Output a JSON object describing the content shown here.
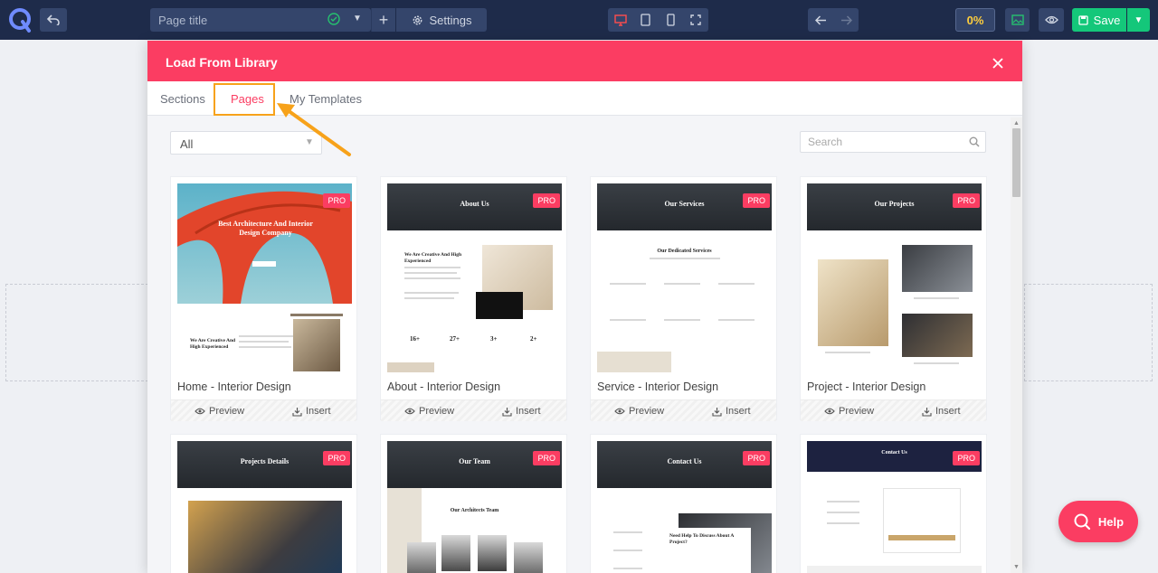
{
  "toolbar": {
    "title_placeholder": "Page title",
    "settings_label": "Settings",
    "progress": "0%",
    "save_label": "Save"
  },
  "modal": {
    "title": "Load From Library",
    "tabs": [
      {
        "label": "Sections"
      },
      {
        "label": "Pages"
      },
      {
        "label": "My Templates"
      }
    ],
    "filter_value": "All",
    "search_placeholder": "Search",
    "cards": [
      {
        "name": "Home - Interior Design",
        "badge": "PRO",
        "preview": "Preview",
        "insert": "Insert",
        "thumb_heading": "Best Architecture And Interior Design Company",
        "thumb_sub": "We Are Creative And High Experienced"
      },
      {
        "name": "About - Interior Design",
        "badge": "PRO",
        "preview": "Preview",
        "insert": "Insert",
        "thumb_heading": "About Us",
        "thumb_sub": "We Are Creative And High Experienced",
        "stats": [
          "16+",
          "27+",
          "3+",
          "2+"
        ]
      },
      {
        "name": "Service - Interior Design",
        "badge": "PRO",
        "preview": "Preview",
        "insert": "Insert",
        "thumb_heading": "Our Services",
        "thumb_sub": "Our Dedicated Services"
      },
      {
        "name": "Project - Interior Design",
        "badge": "PRO",
        "preview": "Preview",
        "insert": "Insert",
        "thumb_heading": "Our Projects"
      },
      {
        "badge": "PRO",
        "thumb_heading": "Projects Details"
      },
      {
        "badge": "PRO",
        "thumb_heading": "Our Team",
        "thumb_sub": "Our Architects Team"
      },
      {
        "badge": "PRO",
        "thumb_heading": "Contact Us",
        "thumb_sub": "Need Help To Discuss About A Project?"
      },
      {
        "badge": "PRO",
        "thumb_heading": "Contact Us"
      }
    ]
  },
  "help_label": "Help",
  "colors": {
    "toolbar_bg": "#1e2b4a",
    "accent": "#fb3d62",
    "save": "#14c77a",
    "progress_text": "#ffce3d",
    "highlight": "#f7a21a"
  }
}
